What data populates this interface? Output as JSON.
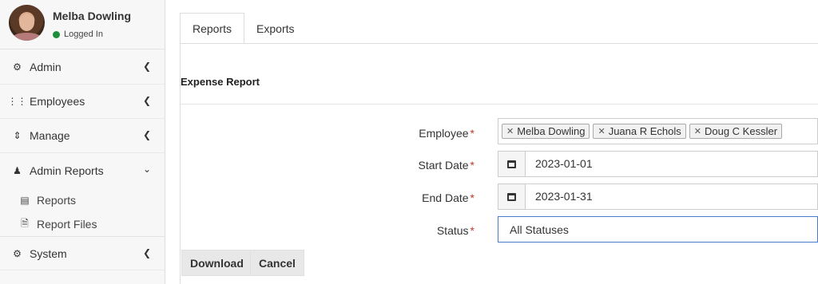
{
  "user": {
    "name": "Melba Dowling",
    "status": "Logged In",
    "status_color": "#1d8f3a"
  },
  "sidebar": {
    "items": [
      {
        "label": "Admin",
        "icon": "users-cog-icon"
      },
      {
        "label": "Employees",
        "icon": "grid-icon"
      },
      {
        "label": "Manage",
        "icon": "arrows-icon"
      },
      {
        "label": "Admin Reports",
        "icon": "user-tie-icon",
        "expanded": true
      },
      {
        "label": "System",
        "icon": "cogs-icon"
      }
    ],
    "subitems": [
      {
        "label": "Reports",
        "icon": "report-icon"
      },
      {
        "label": "Report Files",
        "icon": "file-export-icon"
      }
    ]
  },
  "tabs": [
    {
      "label": "Reports",
      "active": true
    },
    {
      "label": "Exports",
      "active": false
    }
  ],
  "form": {
    "title": "Expense Report",
    "required_marker": "*",
    "employee": {
      "label": "Employee",
      "values": [
        "Melba Dowling",
        "Juana R Echols",
        "Doug C Kessler"
      ]
    },
    "start_date": {
      "label": "Start Date",
      "value": "2023-01-01"
    },
    "end_date": {
      "label": "End Date",
      "value": "2023-01-31"
    },
    "status": {
      "label": "Status",
      "value": "All Statuses"
    }
  },
  "buttons": {
    "download": "Download",
    "cancel": "Cancel"
  }
}
